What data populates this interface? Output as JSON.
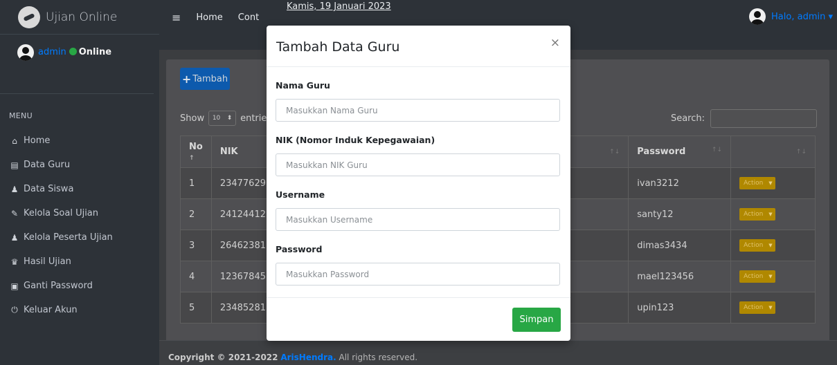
{
  "sidebar": {
    "brand": "Ujian Online",
    "user_name": "admin",
    "status": "Online",
    "menu_header": "MENU",
    "items": [
      {
        "label": "Home",
        "icon": "home-icon",
        "glyph": "⌂"
      },
      {
        "label": "Data Guru",
        "icon": "id-card-icon",
        "glyph": "▤"
      },
      {
        "label": "Data Siswa",
        "icon": "user-graduate-icon",
        "glyph": "♟"
      },
      {
        "label": "Kelola Soal Ujian",
        "icon": "edit-icon",
        "glyph": "✎"
      },
      {
        "label": "Kelola Peserta Ujian",
        "icon": "users-icon",
        "glyph": "♟"
      },
      {
        "label": "Hasil Ujian",
        "icon": "trophy-icon",
        "glyph": "♛"
      },
      {
        "label": "Ganti Password",
        "icon": "lock-icon",
        "glyph": "▣"
      },
      {
        "label": "Keluar Akun",
        "icon": "power-icon",
        "glyph": "⏻"
      }
    ]
  },
  "navbar": {
    "menu_icon": "≡",
    "home": "Home",
    "contact": "Cont",
    "date": "Kamis, 19 Januari 2023",
    "greeting": "Halo, admin ▾"
  },
  "content": {
    "add_button": "Tambah",
    "show_label": "Show",
    "show_value": "10",
    "entries_label": "entrie",
    "search_label": "Search:",
    "columns": [
      "No",
      "NIK",
      "",
      "Password",
      ""
    ],
    "rows": [
      {
        "no": "1",
        "nik": "23477629",
        "password": "ivan3212",
        "action": "Action"
      },
      {
        "no": "2",
        "nik": "24124412",
        "password": "santy12",
        "action": "Action"
      },
      {
        "no": "3",
        "nik": "26462381",
        "password": "dimas3434",
        "action": "Action"
      },
      {
        "no": "4",
        "nik": "12367845",
        "password": "mael123456",
        "action": "Action"
      },
      {
        "no": "5",
        "nik": "23485281",
        "password": "upin123",
        "action": "Action"
      }
    ]
  },
  "footer": {
    "copyright": "Copyright © 2021-2022",
    "author": "ArisHendra.",
    "rights": "All rights reserved."
  },
  "modal": {
    "title": "Tambah Data Guru",
    "close": "×",
    "fields": [
      {
        "label": "Nama Guru",
        "placeholder": "Masukkan Nama Guru"
      },
      {
        "label": "NIK (Nomor Induk Kepegawaian)",
        "placeholder": "Masukkan NIK Guru"
      },
      {
        "label": "Username",
        "placeholder": "Masukkan Username"
      },
      {
        "label": "Password",
        "placeholder": "Masukkan Password"
      }
    ],
    "submit": "Simpan"
  },
  "colors": {
    "accent": "#007bff",
    "success": "#28a745",
    "warning": "#b08800",
    "sidebar_bg": "#2d3238"
  }
}
